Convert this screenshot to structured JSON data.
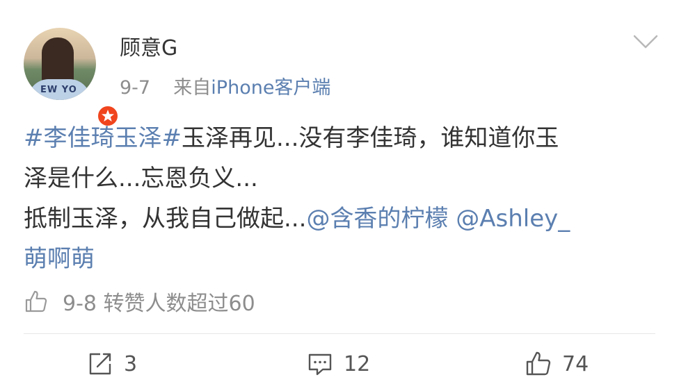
{
  "post": {
    "author": "顾意G",
    "meta": {
      "date": "9-7",
      "source_prefix": "来自",
      "source": "iPhone客户端"
    },
    "body": {
      "line1_topic": "#李佳琦玉泽#",
      "line1_text": "玉泽再见...没有李佳琦，谁知道你玉",
      "line2_text": "泽是什么...忘恩负义...",
      "line3_text": "抵制玉泽，从我自己做起...",
      "line3_mention1": "@含香的柠檬",
      "line3_mention2": "@Ashley_",
      "line4_mention2_cont": "萌啊萌"
    },
    "likes_summary": "9-8 转赞人数超过60",
    "actions": {
      "repost_count": "3",
      "comment_count": "12",
      "like_count": "74"
    },
    "icons": {
      "more": "chevron-down-icon",
      "verify": "verified-badge-icon",
      "like_small": "thumbs-up-icon",
      "repost": "repost-icon",
      "comment": "comment-icon",
      "like": "thumbs-up-icon"
    },
    "colors": {
      "link": "#5b7fb0",
      "text": "#333333",
      "muted": "#8d8d8d",
      "badge": "#f0451e"
    }
  }
}
